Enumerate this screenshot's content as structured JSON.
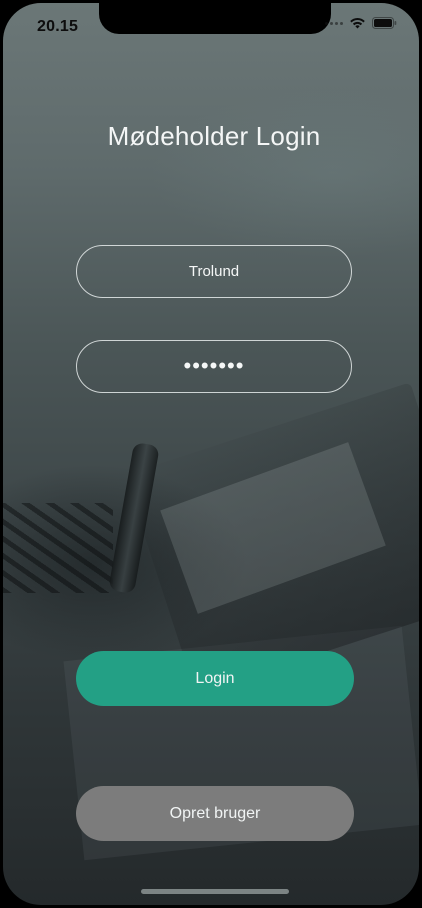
{
  "status_bar": {
    "time": "20.15"
  },
  "screen": {
    "title": "Mødeholder Login"
  },
  "form": {
    "username_value": "Trolund",
    "password_masked": "•••••••"
  },
  "buttons": {
    "login_label": "Login",
    "create_label": "Opret bruger"
  },
  "colors": {
    "login_button": "#23a085",
    "create_button": "#7c7c7c",
    "background_top": "#6b7777",
    "background_bottom": "#24292b"
  },
  "icons": {
    "wifi": "wifi-icon",
    "battery": "battery-icon",
    "signal": "signal-icon"
  }
}
